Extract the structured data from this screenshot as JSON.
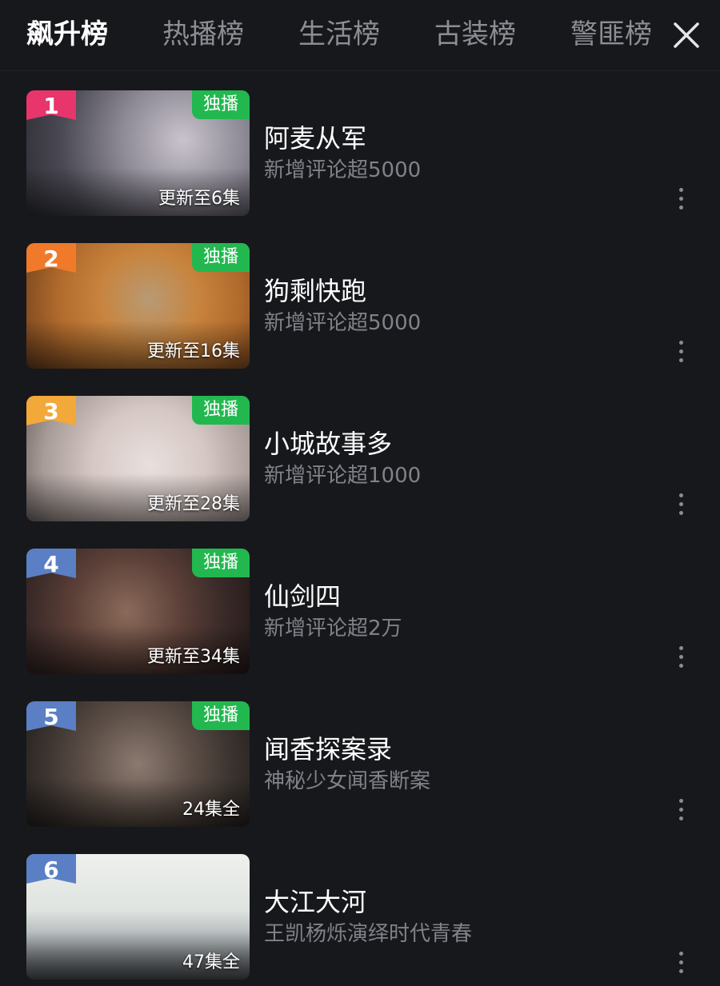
{
  "tabs": [
    {
      "label": "飙升榜",
      "active": true
    },
    {
      "label": "热播榜",
      "active": false
    },
    {
      "label": "生活榜",
      "active": false
    },
    {
      "label": "古装榜",
      "active": false
    },
    {
      "label": "警匪榜",
      "active": false
    }
  ],
  "close_icon": "close-icon",
  "exclusive_label": "独播",
  "colors": {
    "background": "#17181c",
    "accent_green": "#22b84f",
    "subtitle_gray": "#7f8288",
    "rank_1": "#e8356b",
    "rank_2": "#f07a2a",
    "rank_3": "#f2a93a",
    "rank_other": "#5b7fc4"
  },
  "items": [
    {
      "rank": "1",
      "title": "阿麦从军",
      "subtitle": "新增评论超5000",
      "episodes": "更新至6集",
      "exclusive": true
    },
    {
      "rank": "2",
      "title": "狗剩快跑",
      "subtitle": "新增评论超5000",
      "episodes": "更新至16集",
      "exclusive": true
    },
    {
      "rank": "3",
      "title": "小城故事多",
      "subtitle": "新增评论超1000",
      "episodes": "更新至28集",
      "exclusive": true
    },
    {
      "rank": "4",
      "title": "仙剑四",
      "subtitle": "新增评论超2万",
      "episodes": "更新至34集",
      "exclusive": true
    },
    {
      "rank": "5",
      "title": "闻香探案录",
      "subtitle": "神秘少女闻香断案",
      "episodes": "24集全",
      "exclusive": true
    },
    {
      "rank": "6",
      "title": "大江大河",
      "subtitle": "王凯杨烁演绎时代青春",
      "episodes": "47集全",
      "exclusive": false
    }
  ]
}
